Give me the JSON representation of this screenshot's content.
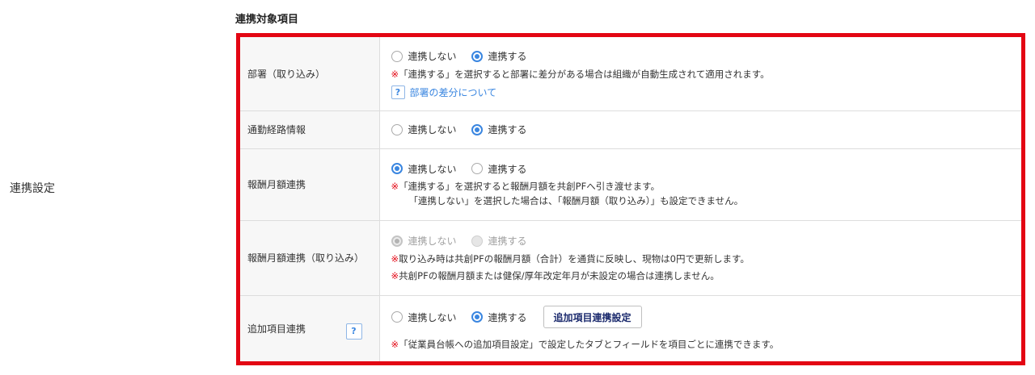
{
  "page_label": "連携設定",
  "section_title": "連携対象項目",
  "rows": [
    {
      "label": "部署（取り込み）",
      "options": [
        "連携しない",
        "連携する"
      ],
      "selected": 1,
      "note_mark": "※",
      "note": "「連携する」を選択すると部署に差分がある場合は組織が自動生成されて適用されます。",
      "help_icon": "?",
      "help_link": "部署の差分について"
    },
    {
      "label": "通勤経路情報",
      "options": [
        "連携しない",
        "連携する"
      ],
      "selected": 1
    },
    {
      "label": "報酬月額連携",
      "options": [
        "連携しない",
        "連携する"
      ],
      "selected": 0,
      "note_mark": "※",
      "note": "「連携する」を選択すると報酬月額を共創PFへ引き渡せます。",
      "note2": "「連携しない」を選択した場合は、「報酬月額（取り込み）」も設定できません。"
    },
    {
      "label": "報酬月額連携（取り込み）",
      "options": [
        "連携しない",
        "連携する"
      ],
      "selected": 0,
      "disabled": true,
      "note_mark": "※",
      "note": "取り込み時は共創PFの報酬月額（合計）を通貨に反映し、現物は0円で更新します。",
      "note2_mark": "※",
      "note2": "共創PFの報酬月額または健保/厚年改定年月が未設定の場合は連携しません。"
    },
    {
      "label": "追加項目連携",
      "label_help_icon": "?",
      "options": [
        "連携しない",
        "連携する"
      ],
      "selected": 1,
      "button": "追加項目連携設定",
      "note_mark": "※",
      "note": "「従業員台帳への追加項目設定」で設定したタブとフィールドを項目ごとに連携できます。"
    }
  ],
  "colors": {
    "accent": "#3a86e0",
    "highlight": "#e30613",
    "header_bg": "#f7f7f7",
    "button_text": "#1c2b6e"
  },
  "icons": {
    "help": "question-icon"
  }
}
